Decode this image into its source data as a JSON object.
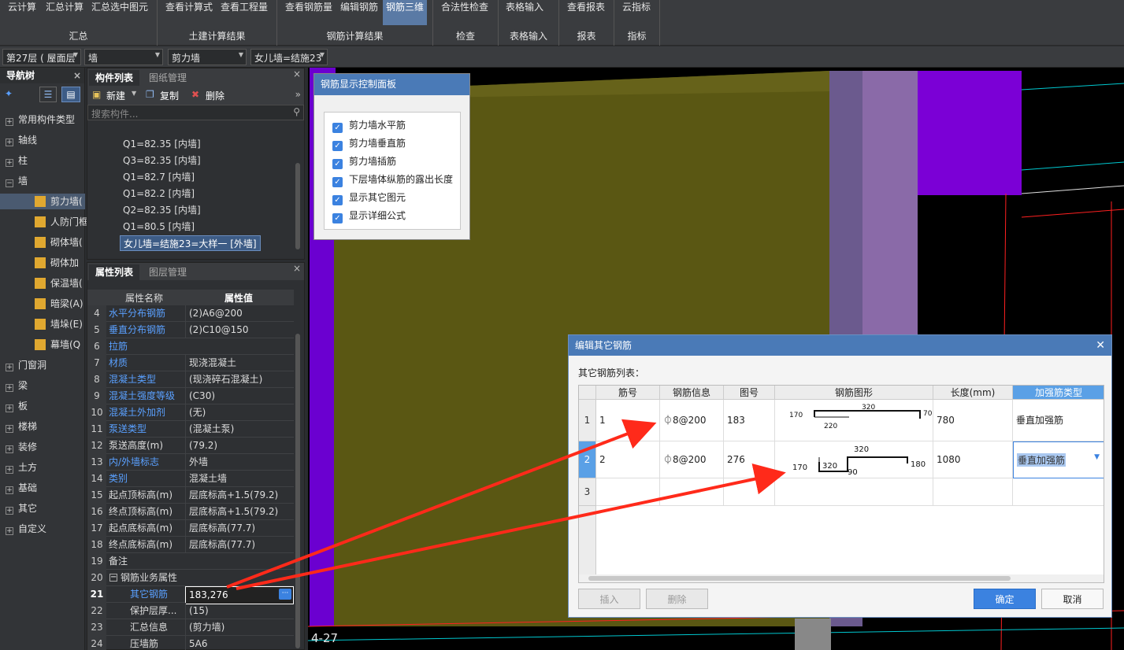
{
  "ribbon": {
    "groups": [
      {
        "label": "汇总",
        "buttons": [
          "云计算",
          "汇总计算",
          "汇总选中图元"
        ]
      },
      {
        "label": "土建计算结果",
        "buttons": [
          "查看计算式",
          "查看工程量"
        ]
      },
      {
        "label": "钢筋计算结果",
        "buttons": [
          "查看钢筋量",
          "编辑钢筋",
          "钢筋三维"
        ]
      },
      {
        "label": "检查",
        "buttons": [
          "合法性检查"
        ]
      },
      {
        "label": "表格输入",
        "buttons": [
          "表格输入"
        ]
      },
      {
        "label": "报表",
        "buttons": [
          "查看报表"
        ]
      },
      {
        "label": "指标",
        "buttons": [
          "云指标"
        ]
      }
    ],
    "active_button": "钢筋三维"
  },
  "selectors": {
    "floor": "第27层 ( 屋面层",
    "category": "墙",
    "type": "剪力墙",
    "component": "女儿墙=结施23"
  },
  "nav": {
    "title": "导航树",
    "items": [
      {
        "label": "常用构件类型",
        "pm": "+"
      },
      {
        "label": "轴线",
        "pm": "+"
      },
      {
        "label": "柱",
        "pm": "+"
      },
      {
        "label": "墙",
        "pm": "−"
      },
      {
        "label": "剪力墙(",
        "sub": true,
        "selected": true
      },
      {
        "label": "人防门框",
        "sub": true
      },
      {
        "label": "砌体墙(",
        "sub": true
      },
      {
        "label": "砌体加",
        "sub": true
      },
      {
        "label": "保温墙(",
        "sub": true
      },
      {
        "label": "暗梁(A)",
        "sub": true
      },
      {
        "label": "墙垛(E)",
        "sub": true
      },
      {
        "label": "幕墙(Q",
        "sub": true
      },
      {
        "label": "门窗洞",
        "pm": "+"
      },
      {
        "label": "梁",
        "pm": "+"
      },
      {
        "label": "板",
        "pm": "+"
      },
      {
        "label": "楼梯",
        "pm": "+"
      },
      {
        "label": "装修",
        "pm": "+"
      },
      {
        "label": "土方",
        "pm": "+"
      },
      {
        "label": "基础",
        "pm": "+"
      },
      {
        "label": "其它",
        "pm": "+"
      },
      {
        "label": "自定义",
        "pm": "+"
      }
    ]
  },
  "component_panel": {
    "tabs": [
      "构件列表",
      "图纸管理"
    ],
    "toolbar": {
      "new": "新建",
      "copy": "复制",
      "delete": "删除"
    },
    "search_placeholder": "搜索构件...",
    "items": [
      "Q1=82.35 [内墙]",
      "Q3=82.35 [内墙]",
      "Q1=82.7 [内墙]",
      "Q1=82.2 [内墙]",
      "Q2=82.35 [内墙]",
      "Q1=80.5 [内墙]",
      "女儿墙=结施23=大样一 [外墙]"
    ]
  },
  "property_panel": {
    "tabs": [
      "属性列表",
      "图层管理"
    ],
    "headers": [
      "属性名称",
      "属性值"
    ],
    "rows": [
      {
        "n": "4",
        "k": "水平分布钢筋",
        "v": "(2)A6@200",
        "blue": true
      },
      {
        "n": "5",
        "k": "垂直分布钢筋",
        "v": "(2)C10@150",
        "blue": true
      },
      {
        "n": "6",
        "k": "拉筋",
        "v": "",
        "blue": true
      },
      {
        "n": "7",
        "k": "材质",
        "v": "现浇混凝土",
        "blue": true
      },
      {
        "n": "8",
        "k": "混凝土类型",
        "v": "(现浇碎石混凝土)",
        "blue": true
      },
      {
        "n": "9",
        "k": "混凝土强度等级",
        "v": "(C30)",
        "blue": true
      },
      {
        "n": "10",
        "k": "混凝土外加剂",
        "v": "(无)",
        "blue": true
      },
      {
        "n": "11",
        "k": "泵送类型",
        "v": "(混凝土泵)",
        "blue": true
      },
      {
        "n": "12",
        "k": "泵送高度(m)",
        "v": "(79.2)",
        "blue": false
      },
      {
        "n": "13",
        "k": "内/外墙标志",
        "v": "外墙",
        "blue": true
      },
      {
        "n": "14",
        "k": "类别",
        "v": "混凝土墙",
        "blue": true
      },
      {
        "n": "15",
        "k": "起点顶标高(m)",
        "v": "层底标高+1.5(79.2)",
        "blue": false
      },
      {
        "n": "16",
        "k": "终点顶标高(m)",
        "v": "层底标高+1.5(79.2)",
        "blue": false
      },
      {
        "n": "17",
        "k": "起点底标高(m)",
        "v": "层底标高(77.7)",
        "blue": false
      },
      {
        "n": "18",
        "k": "终点底标高(m)",
        "v": "层底标高(77.7)",
        "blue": false
      },
      {
        "n": "19",
        "k": "备注",
        "v": "",
        "blue": false
      },
      {
        "n": "20",
        "k": "钢筋业务属性",
        "v": "",
        "blue": false
      },
      {
        "n": "21",
        "k": "其它钢筋",
        "v": "183,276",
        "blue": true
      },
      {
        "n": "22",
        "k": "保护层厚...",
        "v": "(15)",
        "blue": false
      },
      {
        "n": "23",
        "k": "汇总信息",
        "v": "(剪力墙)",
        "blue": false
      },
      {
        "n": "24",
        "k": "压墙筋",
        "v": "5A6",
        "blue": false
      }
    ]
  },
  "control_panel": {
    "title": "钢筋显示控制面板",
    "options": [
      "剪力墙水平筋",
      "剪力墙垂直筋",
      "剪力墙插筋",
      "下层墙体纵筋的露出长度",
      "显示其它图元",
      "显示详细公式"
    ]
  },
  "dialog": {
    "title": "编辑其它钢筋",
    "list_label": "其它钢筋列表：",
    "headers": [
      "筋号",
      "钢筋信息",
      "图号",
      "钢筋图形",
      "长度(mm)",
      "加强筋类型"
    ],
    "rows": [
      {
        "n": "1",
        "no": "1",
        "info": "⏀8@200",
        "fig": "183",
        "len": "780",
        "type": "垂直加强筋",
        "shape": {
          "a": "170",
          "b": "320",
          "c": "70",
          "d": "220"
        }
      },
      {
        "n": "2",
        "no": "2",
        "info": "⏀8@200",
        "fig": "276",
        "len": "1080",
        "type": "垂直加强筋",
        "shape": {
          "a": "320",
          "b": "170",
          "c": "320",
          "d": "90",
          "e": "180"
        }
      },
      {
        "n": "3",
        "no": "",
        "info": "",
        "fig": "",
        "len": "",
        "type": ""
      }
    ],
    "buttons": {
      "insert": "插入",
      "delete": "删除",
      "ok": "确定",
      "cancel": "取消"
    }
  },
  "canvas": {
    "axis_label": "4-27"
  },
  "colors": {
    "ribbon": "#3a3c3f",
    "accent": "#4a7ab7",
    "wall_olive": "#5a5713",
    "wall_purple": "#7b00d6",
    "arrow": "#ff2a1a"
  }
}
